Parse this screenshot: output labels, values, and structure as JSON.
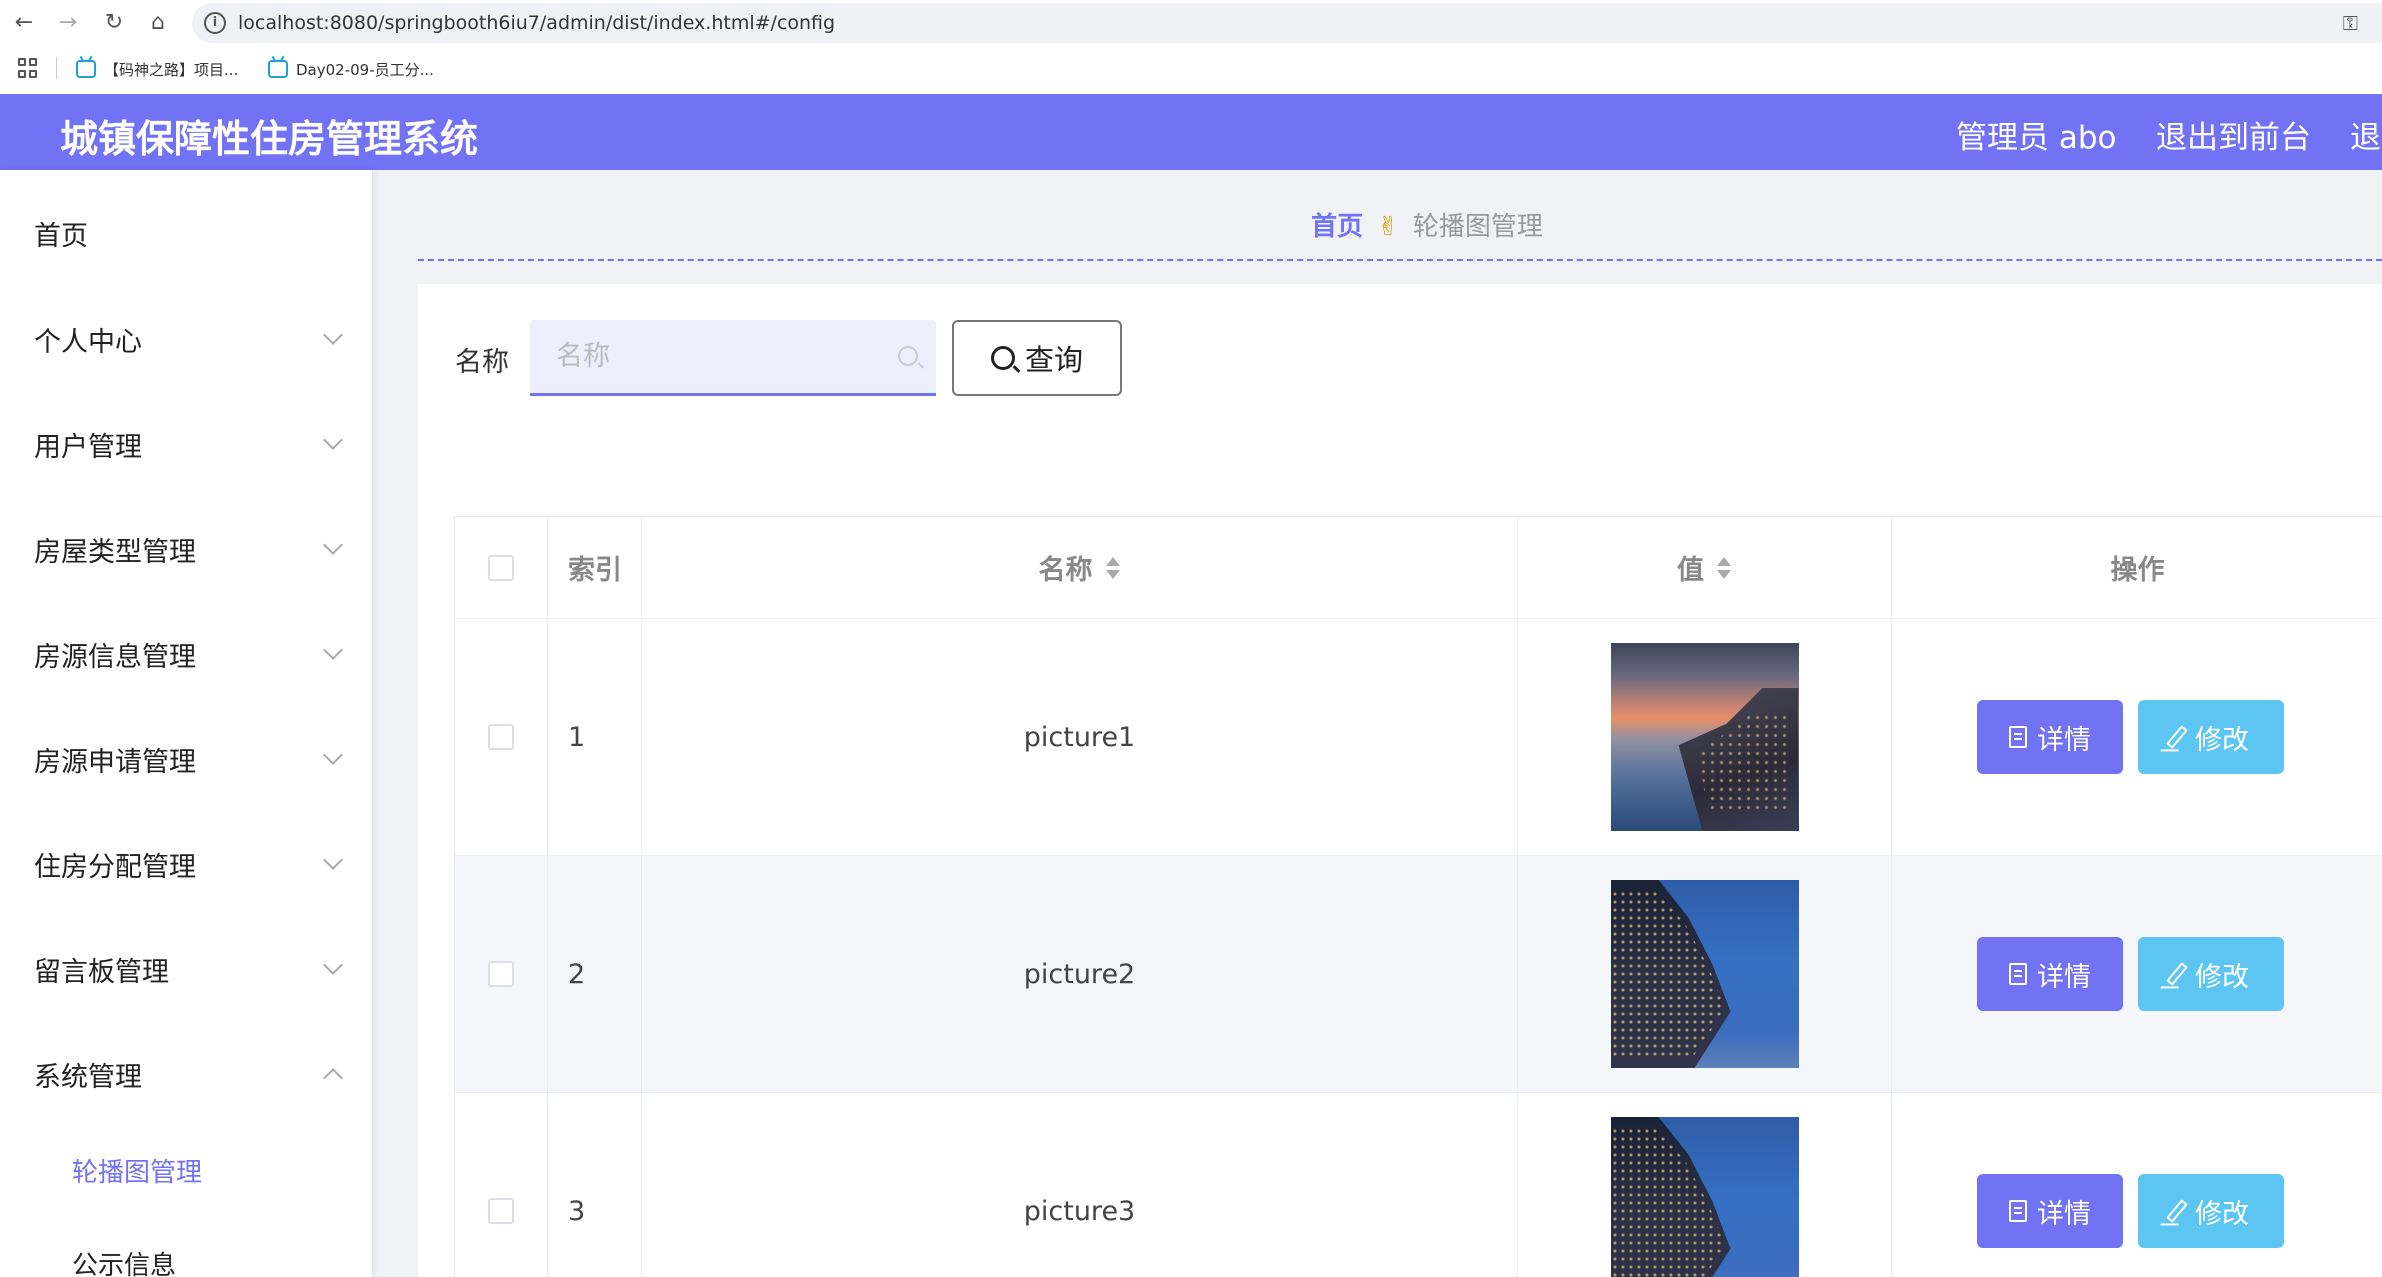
{
  "browser": {
    "url": "localhost:8080/springbooth6iu7/admin/dist/index.html#/config",
    "bookmarks": [
      {
        "label": "【码神之路】项目..."
      },
      {
        "label": "Day02-09-员工分..."
      }
    ]
  },
  "header": {
    "title": "城镇保障性住房管理系统",
    "user_label": "管理员 abo",
    "front_link": "退出到前台",
    "logout_label": "退"
  },
  "sidebar": {
    "items": [
      {
        "label": "首页"
      },
      {
        "label": "个人中心"
      },
      {
        "label": "用户管理"
      },
      {
        "label": "房屋类型管理"
      },
      {
        "label": "房源信息管理"
      },
      {
        "label": "房源申请管理"
      },
      {
        "label": "住房分配管理"
      },
      {
        "label": "留言板管理"
      },
      {
        "label": "系统管理"
      }
    ],
    "sub_items": [
      {
        "label": "轮播图管理"
      },
      {
        "label": "公示信息"
      }
    ]
  },
  "breadcrumb": {
    "home": "首页",
    "current": "轮播图管理"
  },
  "search": {
    "label": "名称",
    "placeholder": "名称",
    "button_label": "查询"
  },
  "table": {
    "columns": {
      "index": "索引",
      "name": "名称",
      "value": "值",
      "ops": "操作"
    },
    "rows": [
      {
        "index": "1",
        "name": "picture1"
      },
      {
        "index": "2",
        "name": "picture2"
      },
      {
        "index": "3",
        "name": "picture3"
      }
    ],
    "detail_label": "详情",
    "edit_label": "修改"
  },
  "colors": {
    "primary": "#7272f5",
    "edit_button": "#5dc5f2"
  }
}
